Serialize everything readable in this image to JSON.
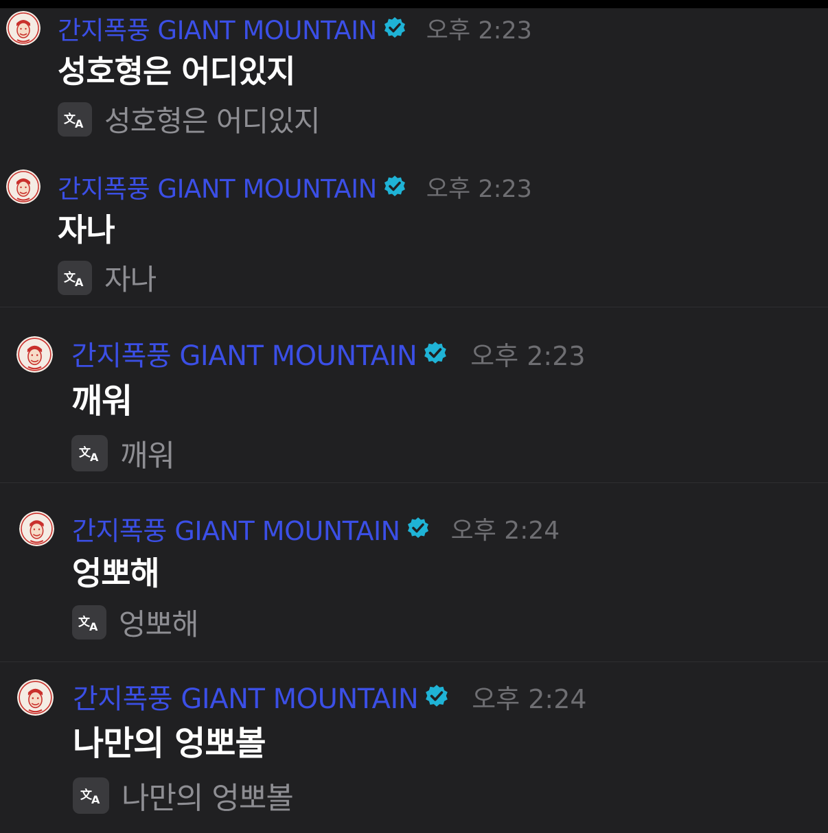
{
  "icons": {
    "avatar": "avatar-face-icon",
    "verified": "verified-check-icon",
    "translate": "translate-icon"
  },
  "colors": {
    "background": "#202022",
    "username": "#3b4fe6",
    "verified_badge": "#1fb3d6",
    "timestamp": "#6e6e72",
    "message": "#ffffff",
    "translation": "#8e8e93"
  },
  "messages": [
    {
      "username": "간지폭풍 GIANT MOUNTAIN",
      "time": "오후 2:23",
      "text": "성호형은 어디있지",
      "translation": "성호형은 어디있지"
    },
    {
      "username": "간지폭풍 GIANT MOUNTAIN",
      "time": "오후 2:23",
      "text": "자나",
      "translation": "자나"
    },
    {
      "username": "간지폭풍 GIANT MOUNTAIN",
      "time": "오후 2:23",
      "text": "깨워",
      "translation": "깨워"
    },
    {
      "username": "간지폭풍 GIANT MOUNTAIN",
      "time": "오후 2:24",
      "text": "엉뽀해",
      "translation": "엉뽀해"
    },
    {
      "username": "간지폭풍 GIANT MOUNTAIN",
      "time": "오후 2:24",
      "text": "나만의 엉뽀볼",
      "translation": "나만의 엉뽀볼"
    }
  ]
}
